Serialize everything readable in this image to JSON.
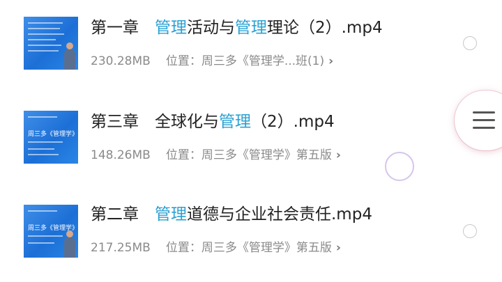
{
  "files": [
    {
      "title_pre": "第一章　",
      "title_hl1": "管理",
      "title_mid": "活动与",
      "title_hl2": "管理",
      "title_post": "理论（2）.mp4",
      "size": "230.28MB",
      "location": "位置：周三多《管理学...班(1)"
    },
    {
      "title_pre": "第三章　全球化与",
      "title_hl1": "管理",
      "title_mid": "（2）.mp4",
      "title_hl2": "",
      "title_post": "",
      "size": "148.26MB",
      "location": "位置：周三多《管理学》第五版",
      "thumb_text": "周三多《管理学》"
    },
    {
      "title_pre": "第二章　",
      "title_hl1": "管理",
      "title_mid": "道德与企业社会责任.mp4",
      "title_hl2": "",
      "title_post": "",
      "size": "217.25MB",
      "location": "位置：周三多《管理学》第五版",
      "thumb_text": "周三多《管理学》"
    }
  ],
  "icons": {
    "chevron": "›",
    "radio": "select-circle",
    "menu": "hamburger-menu"
  },
  "colors": {
    "highlight": "#2ba1d4",
    "thumb_blue": "#1c6fd6"
  }
}
